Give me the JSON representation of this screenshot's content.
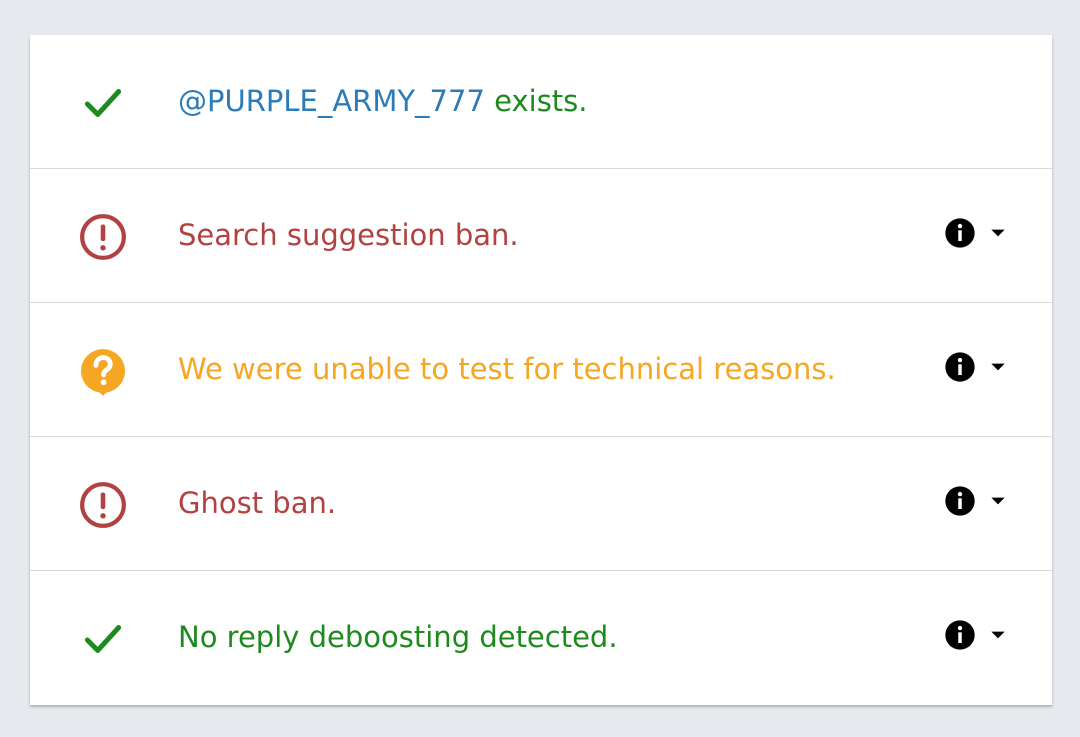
{
  "rows": [
    {
      "id": "exists",
      "status": "ok",
      "icon": "check-icon",
      "handle": "@PURPLE_ARMY_777",
      "text": " exists.",
      "has_actions": false
    },
    {
      "id": "search-suggestion-ban",
      "status": "bad",
      "icon": "exclamation-circle-icon",
      "text": "Search suggestion ban.",
      "has_actions": true
    },
    {
      "id": "search-ban",
      "status": "warn",
      "icon": "question-bubble-icon",
      "text": "We were unable to test for technical reasons.",
      "has_actions": true
    },
    {
      "id": "ghost-ban",
      "status": "bad",
      "icon": "exclamation-circle-icon",
      "text": "Ghost ban.",
      "has_actions": true
    },
    {
      "id": "reply-deboosting",
      "status": "ok",
      "icon": "check-icon",
      "text": "No reply deboosting detected.",
      "has_actions": true
    }
  ],
  "actions": {
    "info_icon": "info-icon",
    "expand_icon": "caret-down-icon"
  },
  "colors": {
    "ok": "#1e8a1e",
    "bad": "#b24141",
    "warn": "#f5a623",
    "handle": "#2b7bb9",
    "background": "#e6eaee",
    "card": "#ffffff",
    "divider": "#d8d8d8"
  }
}
